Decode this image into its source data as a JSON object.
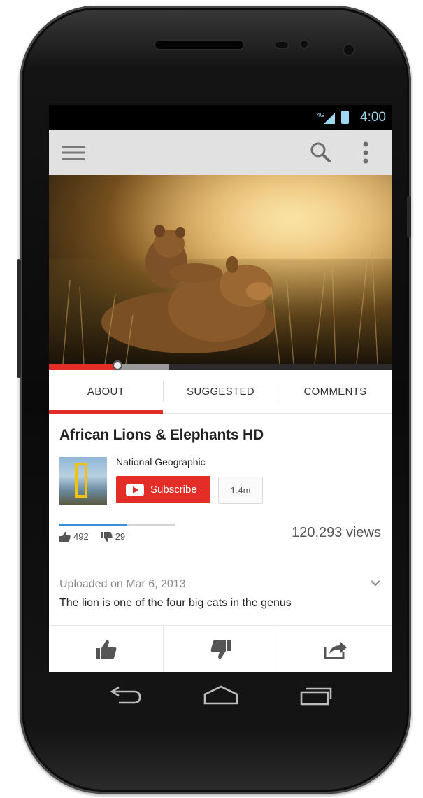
{
  "status_bar": {
    "network": "4G",
    "time": "4:00"
  },
  "app_bar": {
    "menu_icon": "hamburger-menu-icon",
    "search_icon": "search-icon",
    "overflow_icon": "more-vert-icon"
  },
  "player": {
    "progress_played": 0.2,
    "progress_buffered": 0.35
  },
  "tabs": [
    {
      "label": "ABOUT",
      "active": true
    },
    {
      "label": "SUGGESTED",
      "active": false
    },
    {
      "label": "COMMENTS",
      "active": false
    }
  ],
  "video": {
    "title": "African Lions & Elephants HD",
    "channel": "National Geographic",
    "subscribe_label": "Subscribe",
    "subscriber_count": "1.4m",
    "likes": "492",
    "dislikes": "29",
    "like_ratio": 0.59,
    "views": "120,293 views",
    "uploaded": "Uploaded on Mar 6, 2013",
    "description": "The lion is one of the four big cats in the genus"
  },
  "actions": [
    {
      "icon": "thumbs-up-icon"
    },
    {
      "icon": "thumbs-down-icon"
    },
    {
      "icon": "share-icon"
    }
  ],
  "nav_bar": [
    {
      "icon": "back-icon"
    },
    {
      "icon": "home-icon"
    },
    {
      "icon": "recent-apps-icon"
    }
  ],
  "colors": {
    "accent": "#e52d27",
    "status": "#33b5e5",
    "like_bar": "#3a8fd9"
  }
}
